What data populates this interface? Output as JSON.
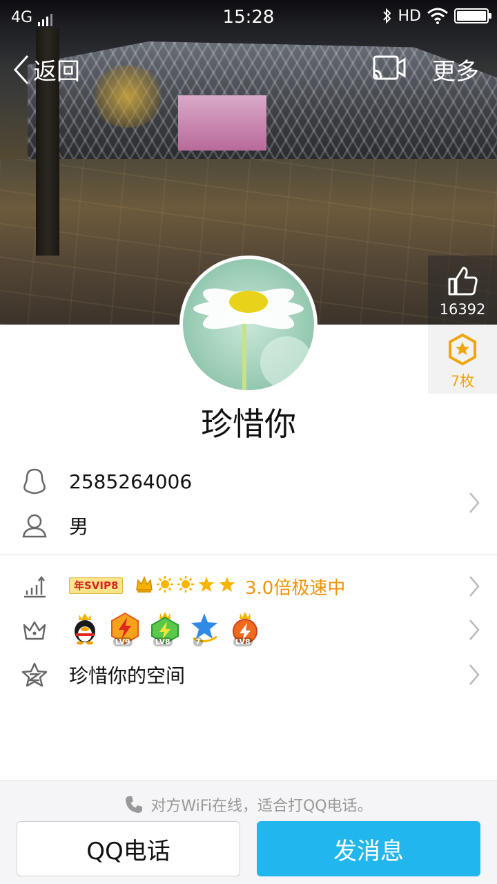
{
  "status_bar": {
    "network": "4G",
    "time": "15:28",
    "hd": "HD"
  },
  "nav": {
    "back_label": "返回",
    "more_label": "更多"
  },
  "profile": {
    "likes": "16392",
    "medals": "7枚",
    "nickname": "珍惜你",
    "qq_number": "2585264006",
    "gender": "男"
  },
  "vip": {
    "tag": "年SVIP8",
    "speed_text": "3.0倍极速中",
    "level_icons": [
      "crown-icon",
      "sun-icon",
      "sun-icon",
      "star-icon",
      "star-icon"
    ]
  },
  "badges": [
    {
      "name": "qq-penguin-badge",
      "label": ""
    },
    {
      "name": "lightning-badge",
      "label": "LV9"
    },
    {
      "name": "green-lightning-badge",
      "label": "LV8"
    },
    {
      "name": "blue-star-badge",
      "label": "7"
    },
    {
      "name": "orange-lightning-badge",
      "label": "LV8"
    }
  ],
  "space": {
    "label": "珍惜你的空间"
  },
  "bottom": {
    "tip": "对方WiFi在线，适合打QQ电话。",
    "call_label": "QQ电话",
    "message_label": "发消息"
  },
  "colors": {
    "accent": "#22b6ee",
    "speed": "#f0930a",
    "medal": "#f0a60a"
  }
}
